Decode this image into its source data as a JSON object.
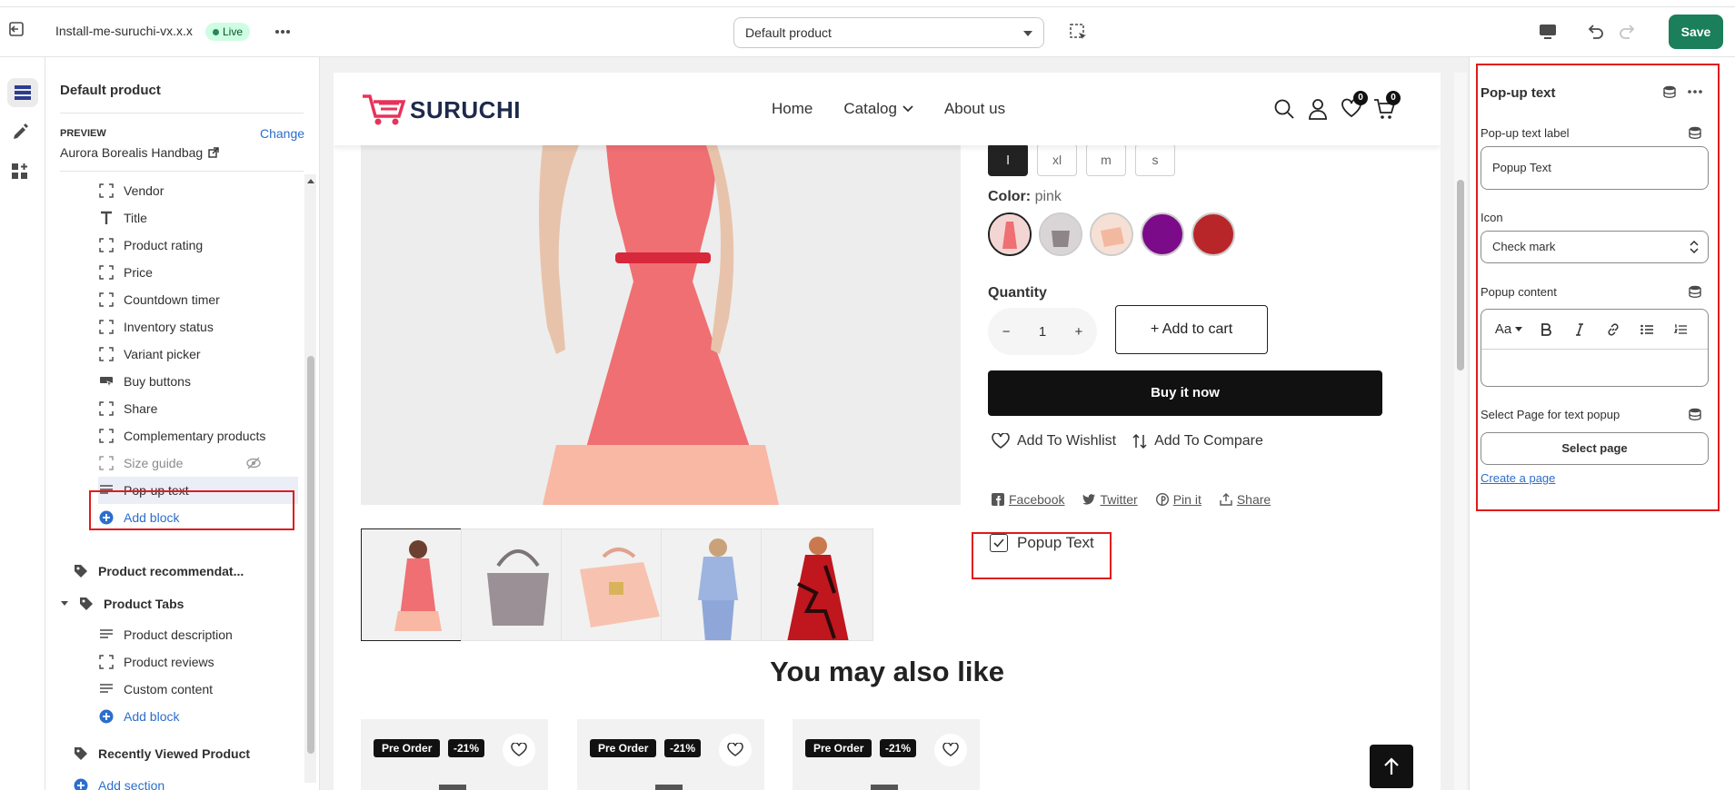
{
  "topbar": {
    "store_name": "Install-me-suruchi-vx.x.x",
    "live_label": "Live",
    "template_select": "Default product",
    "save_label": "Save"
  },
  "sidebar": {
    "title": "Default product",
    "preview_label": "PREVIEW",
    "change_label": "Change",
    "preview_value": "Aurora Borealis Handbag",
    "blocks": [
      {
        "label": "Vendor",
        "icon": "block-icon"
      },
      {
        "label": "Title",
        "icon": "title-icon"
      },
      {
        "label": "Product rating",
        "icon": "block-icon"
      },
      {
        "label": "Price",
        "icon": "block-icon"
      },
      {
        "label": "Countdown timer",
        "icon": "block-icon"
      },
      {
        "label": "Inventory status",
        "icon": "block-icon"
      },
      {
        "label": "Variant picker",
        "icon": "block-icon"
      },
      {
        "label": "Buy buttons",
        "icon": "buy-buttons-icon"
      },
      {
        "label": "Share",
        "icon": "block-icon"
      },
      {
        "label": "Complementary products",
        "icon": "block-icon"
      },
      {
        "label": "Size guide",
        "icon": "block-icon",
        "hidden": true
      },
      {
        "label": "Pop-up text",
        "icon": "text-icon",
        "selected": true
      }
    ],
    "add_block": "Add block",
    "section_product_reco": "Product recommendat...",
    "section_product_tabs": "Product Tabs",
    "tabs_blocks": [
      {
        "label": "Product description",
        "icon": "text-icon"
      },
      {
        "label": "Product reviews",
        "icon": "block-icon"
      },
      {
        "label": "Custom content",
        "icon": "text-icon"
      }
    ],
    "add_block_2": "Add block",
    "section_recently_viewed": "Recently Viewed Product",
    "add_section": "Add section"
  },
  "store": {
    "logo": "SURUCHI",
    "nav": [
      "Home",
      "Catalog",
      "About us"
    ],
    "wishlist_count": "0",
    "cart_count": "0",
    "sizes": [
      "l",
      "xl",
      "m",
      "s"
    ],
    "color_label": "Color:",
    "color_value": "pink",
    "swatch_colors": [
      "#f3d6d3",
      "#d9d5d6",
      "#f6e0d6",
      "#7c0b8a",
      "#b8262a"
    ],
    "quantity_label": "Quantity",
    "qty_minus": "−",
    "qty_value": "1",
    "qty_plus": "+",
    "add_to_cart": "+ Add to cart",
    "buy_now": "Buy it now",
    "add_to_wishlist": "Add To Wishlist",
    "add_to_compare": "Add To Compare",
    "share_links": [
      "Facebook",
      "Twitter",
      "Pin it",
      "Share"
    ],
    "popup_text": "Popup Text",
    "you_may_also_like": "You may also like",
    "card_tag_pre": "Pre Order",
    "card_tag_off": "-21%"
  },
  "rpanel": {
    "title": "Pop-up text",
    "label_field_label": "Pop-up text label",
    "label_field_value": "Popup Text",
    "icon_label": "Icon",
    "icon_value": "Check mark",
    "content_label": "Popup content",
    "rte_font": "Aa",
    "select_page_label": "Select Page for text popup",
    "select_page_button": "Select page",
    "create_page_link": "Create a page"
  },
  "colors": {
    "accent_green": "#1a7f5a",
    "highlight_red": "#e01b1b",
    "link_blue": "#2c6ecb",
    "logo_pink": "#e8325a"
  }
}
